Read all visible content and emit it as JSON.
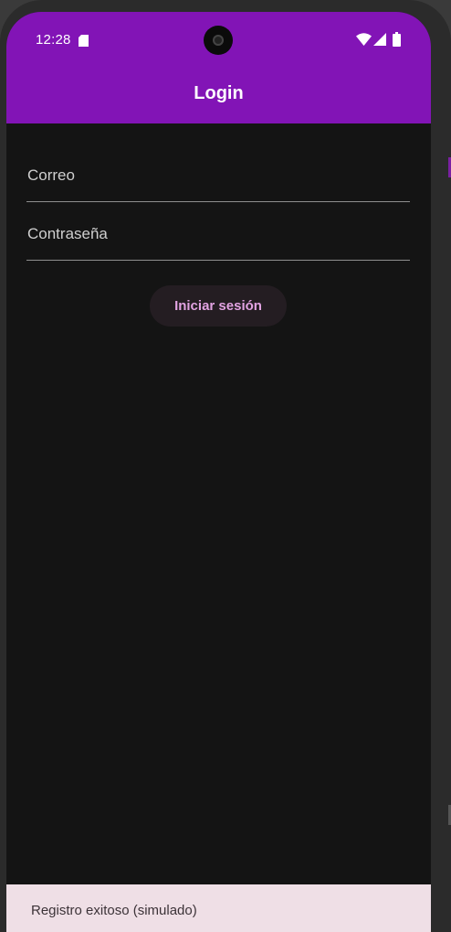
{
  "status_bar": {
    "time": "12:28",
    "icons": [
      "sd-card-icon",
      "wifi-icon",
      "signal-icon",
      "battery-icon"
    ]
  },
  "app_bar": {
    "title": "Login",
    "color": "#8214b6"
  },
  "form": {
    "email_placeholder": "Correo",
    "email_value": "",
    "password_placeholder": "Contraseña",
    "password_value": "",
    "submit_label": "Iniciar sesión"
  },
  "snackbar": {
    "message": "Registro exitoso (simulado)"
  },
  "colors": {
    "background": "#141414",
    "button_text": "#e2a3e2",
    "snackbar_bg": "#efdfe6"
  }
}
